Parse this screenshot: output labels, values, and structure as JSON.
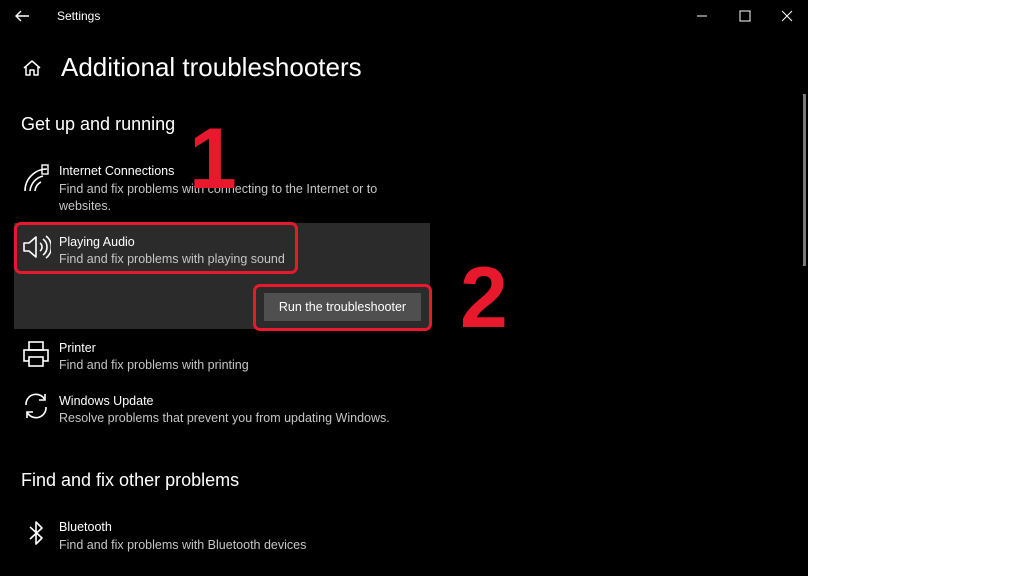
{
  "window": {
    "title": "Settings"
  },
  "page": {
    "title": "Additional troubleshooters"
  },
  "sections": [
    {
      "heading": "Get up and running",
      "items": [
        {
          "name": "Internet Connections",
          "description": "Find and fix problems with connecting to the Internet or to websites.",
          "icon": "wifi-icon"
        },
        {
          "name": "Playing Audio",
          "description": "Find and fix problems with playing sound",
          "icon": "speaker-icon",
          "selected": true
        },
        {
          "name": "Printer",
          "description": "Find and fix problems with printing",
          "icon": "printer-icon"
        },
        {
          "name": "Windows Update",
          "description": "Resolve problems that prevent you from updating Windows.",
          "icon": "sync-icon"
        }
      ]
    },
    {
      "heading": "Find and fix other problems",
      "items": [
        {
          "name": "Bluetooth",
          "description": "Find and fix problems with Bluetooth devices",
          "icon": "bluetooth-icon"
        }
      ]
    }
  ],
  "actions": {
    "run_label": "Run the troubleshooter"
  },
  "annotations": {
    "step1": "1",
    "step2": "2",
    "color": "#e8192c"
  },
  "colors": {
    "background": "#000000",
    "selected_bg": "#2b2b2b",
    "button_bg": "#4f4f4f"
  }
}
